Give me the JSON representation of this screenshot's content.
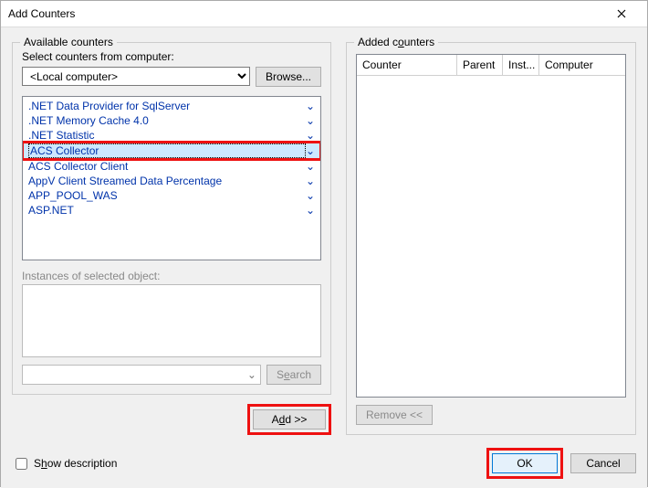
{
  "window": {
    "title": "Add Counters"
  },
  "left": {
    "fieldset_label": "Available counters",
    "select_label": "Select counters from computer:",
    "computer_value": "<Local computer>",
    "browse_label": "Browse...",
    "counters": [
      {
        "label": ".NET Data Provider for SqlServer",
        "selected": false
      },
      {
        "label": ".NET Memory Cache 4.0",
        "selected": false
      },
      {
        "label": ".NET Statistic",
        "selected": false
      },
      {
        "label": "ACS Collector",
        "selected": true
      },
      {
        "label": "ACS Collector Client",
        "selected": false
      },
      {
        "label": "AppV Client Streamed Data Percentage",
        "selected": false
      },
      {
        "label": "APP_POOL_WAS",
        "selected": false
      },
      {
        "label": "ASP.NET",
        "selected": false
      }
    ],
    "instances_label": "Instances of selected object:",
    "search_label": "Search",
    "add_label": "Add >>"
  },
  "right": {
    "fieldset_label": "Added counters",
    "columns": {
      "counter": "Counter",
      "parent": "Parent",
      "inst": "Inst...",
      "computer": "Computer"
    },
    "remove_label": "Remove <<"
  },
  "footer": {
    "show_desc_label": "Show description",
    "ok_label": "OK",
    "cancel_label": "Cancel"
  }
}
